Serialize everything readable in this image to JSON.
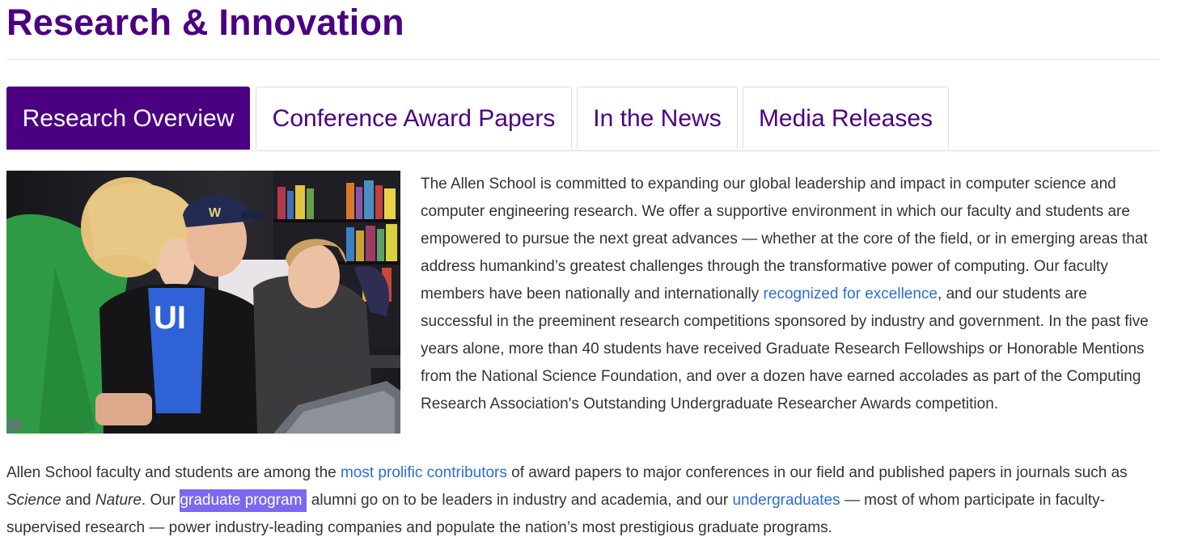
{
  "page": {
    "title": "Research & Innovation"
  },
  "tabs": [
    {
      "label": "Research Overview",
      "active": true
    },
    {
      "label": "Conference Award Papers",
      "active": false
    },
    {
      "label": "In the News",
      "active": false
    },
    {
      "label": "Media Releases",
      "active": false
    }
  ],
  "photo": {
    "cap_text": "W",
    "shirt_text": "UI"
  },
  "intro": {
    "text_a": "The Allen School is committed to expanding our global leadership and impact in computer science and computer engineering research. We offer a supportive environment in which our faculty and students are empowered to pursue the next great advances — whether at the core of the field, or in emerging areas that address humankind’s greatest challenges through the transformative power of computing. Our faculty members have been nationally and internationally ",
    "link_recognized": "recognized for excellence",
    "text_b": ", and our students are successful in the preeminent research competitions sponsored by industry and government. In the past five years alone, more than 40 students have received Graduate Research Fellowships or Honorable Mentions from the National Science Foundation, and over a dozen have earned accolades as part of the Computing Research Association's Outstanding Undergraduate Researcher Awards competition."
  },
  "para2": {
    "text_a": "Allen School faculty and students are among the ",
    "link_prolific": "most prolific contributors",
    "text_b": " of award papers to major conferences in our field and published papers in journals such as ",
    "em_science": "Science",
    "text_c": " and ",
    "em_nature": "Nature",
    "text_d": ". Our ",
    "link_grad": "graduate program",
    "text_e": " alumni go on to be leaders in industry and academia, and our ",
    "link_undergrad": "undergraduates",
    "text_f": " — most of whom participate in faculty-supervised research — power industry-leading companies and populate the nation’s most prestigious graduate programs."
  },
  "colors": {
    "brand_purple": "#4b0082",
    "link_blue": "#2a6ed6",
    "selection": "#7b68ee",
    "body_text": "#333333"
  }
}
